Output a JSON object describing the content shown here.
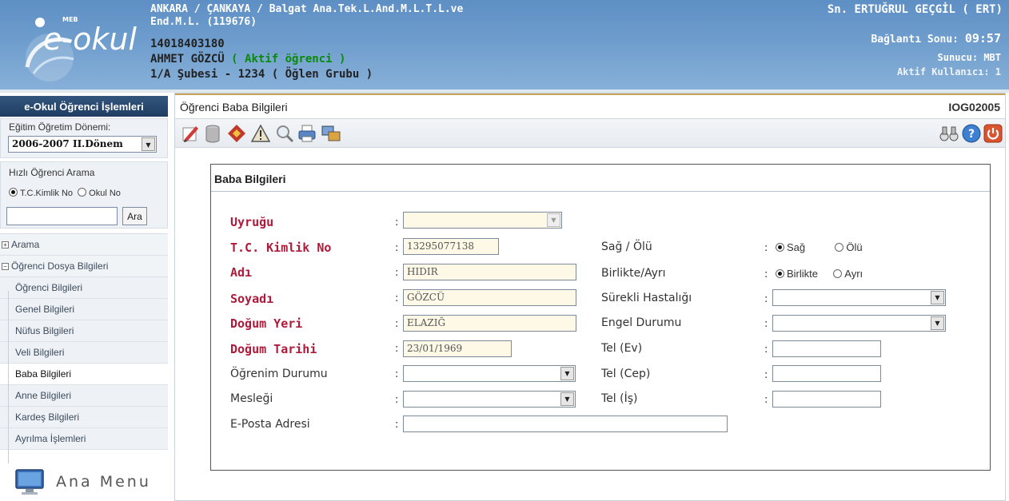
{
  "header": {
    "logo_text": "e-okul",
    "logo_sub": "MEB",
    "school_line1": "ANKARA / ÇANKAYA / Balgat Ana.Tek.L.And.M.L.T.L.ve",
    "school_line2": "End.M.L. (119676)",
    "student_no": "14018403180",
    "student_name": "AHMET GÖZCÜ",
    "student_status": "( Aktif öğrenci )",
    "student_class": "1/A Şubesi - 1234 ( Öğlen Grubu )",
    "user_name": "Sn. ERTUĞRUL GEÇGİL ( ERT)",
    "connection_label": "Bağlantı Sonu:",
    "connection_time": "09:57",
    "server": "Sunucu: MBT",
    "active_users": "Aktif Kullanıcı: 1"
  },
  "sidebar": {
    "title": "e-Okul Öğrenci İşlemleri",
    "term_label": "Eğitim Öğretim Dönemi:",
    "term_value": "2006-2007 II.Dönem",
    "quick_search_title": "Hızlı Öğrenci Arama",
    "radio_tc": "T.C.Kimlik No",
    "radio_school": "Okul No",
    "search_value": "",
    "search_button": "Ara",
    "menu": [
      {
        "label": "Arama",
        "kind": "group",
        "icon": "expand-icon",
        "sign": "+"
      },
      {
        "label": "Öğrenci Dosya Bilgileri",
        "kind": "group",
        "icon": "collapse-icon",
        "sign": "−"
      },
      {
        "label": "Öğrenci Bilgileri",
        "kind": "sub"
      },
      {
        "label": "Genel Bilgileri",
        "kind": "sub"
      },
      {
        "label": "Nüfus Bilgileri",
        "kind": "sub"
      },
      {
        "label": "Veli Bilgileri",
        "kind": "sub"
      },
      {
        "label": "Baba Bilgileri",
        "kind": "sub",
        "active": true
      },
      {
        "label": "Anne Bilgileri",
        "kind": "sub"
      },
      {
        "label": "Kardeş Bilgileri",
        "kind": "sub"
      },
      {
        "label": "Ayrılma İşlemleri",
        "kind": "sub"
      }
    ],
    "home_label": "Ana Menu"
  },
  "main": {
    "title": "Öğrenci Baba Bilgileri",
    "code": "IOG02005",
    "toolbar_icons": [
      "edit-icon",
      "database-icon",
      "erase-icon",
      "warning-icon",
      "search-icon",
      "print-icon",
      "transfer-icon"
    ],
    "toolbar_right_icons": [
      "binoculars-icon",
      "help-icon",
      "power-icon"
    ],
    "panel_title": "Baba Bilgileri",
    "colon": ":",
    "fields": {
      "nationality_label": "Uyruğu",
      "nationality_value": "",
      "tc_label": "T.C. Kimlik No",
      "tc_value": "13295077138",
      "name_label": "Adı",
      "name_value": "HIDIR",
      "surname_label": "Soyadı",
      "surname_value": "GÖZCÜ",
      "birthplace_label": "Doğum Yeri",
      "birthplace_value": "ELAZIĞ",
      "birthdate_label": "Doğum Tarihi",
      "birthdate_value": "23/01/1969",
      "education_label": "Öğrenim Durumu",
      "education_value": "",
      "job_label": "Mesleği",
      "job_value": "",
      "email_label": "E-Posta Adresi",
      "email_value": "",
      "alive_label": "Sağ / Ölü",
      "alive_opt1": "Sağ",
      "alive_opt2": "Ölü",
      "together_label": "Birlikte/Ayrı",
      "together_opt1": "Birlikte",
      "together_opt2": "Ayrı",
      "illness_label": "Sürekli Hastalığı",
      "illness_value": "",
      "disability_label": "Engel Durumu",
      "disability_value": "",
      "tel_home_label": "Tel (Ev)",
      "tel_home_value": "",
      "tel_mobile_label": "Tel (Cep)",
      "tel_mobile_value": "",
      "tel_work_label": "Tel (İş)",
      "tel_work_value": ""
    }
  },
  "colors": {
    "header_blue": "#6e9dcd",
    "sidebar_title": "#1f3d63",
    "required_label": "#b01a3a",
    "active_status": "#0a8a0a",
    "readonly_field": "#fdf9e6"
  }
}
